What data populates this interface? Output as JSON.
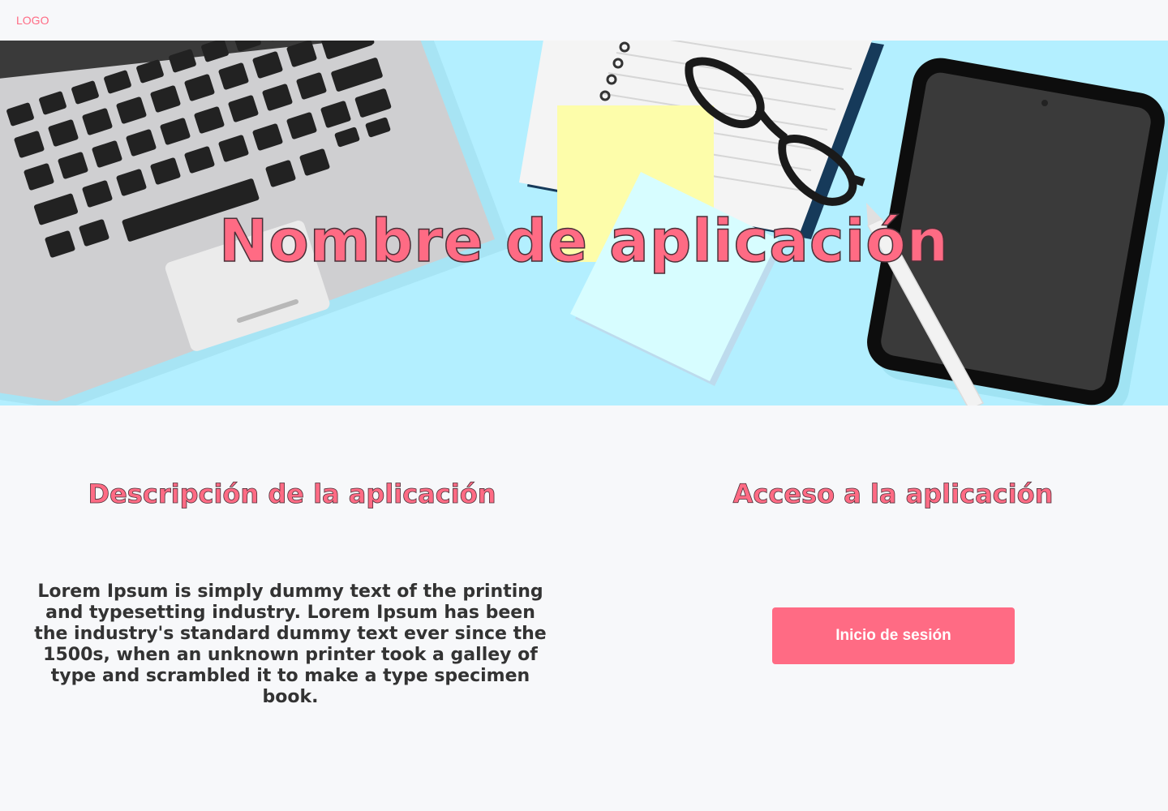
{
  "header": {
    "logo": "LOGO"
  },
  "hero": {
    "title": "Nombre de aplicación"
  },
  "description": {
    "title": "Descripción de la aplicación",
    "text": "Lorem Ipsum is simply dummy text of the printing and typesetting industry. Lorem Ipsum has been the industry's standard dummy text ever since the 1500s, when an unknown printer took a galley of type and scrambled it to make a type specimen book."
  },
  "access": {
    "title": "Acceso a la aplicación",
    "login_label": "Inicio de sesión"
  },
  "colors": {
    "accent": "#ff6b84",
    "hero_background": "#b3efff",
    "page_background": "#f7f8fa",
    "body_text": "#333333"
  },
  "hero_illustration": [
    "laptop-icon",
    "notebook-icon",
    "sticky-note-icon",
    "glasses-icon",
    "tablet-icon",
    "stylus-icon"
  ]
}
